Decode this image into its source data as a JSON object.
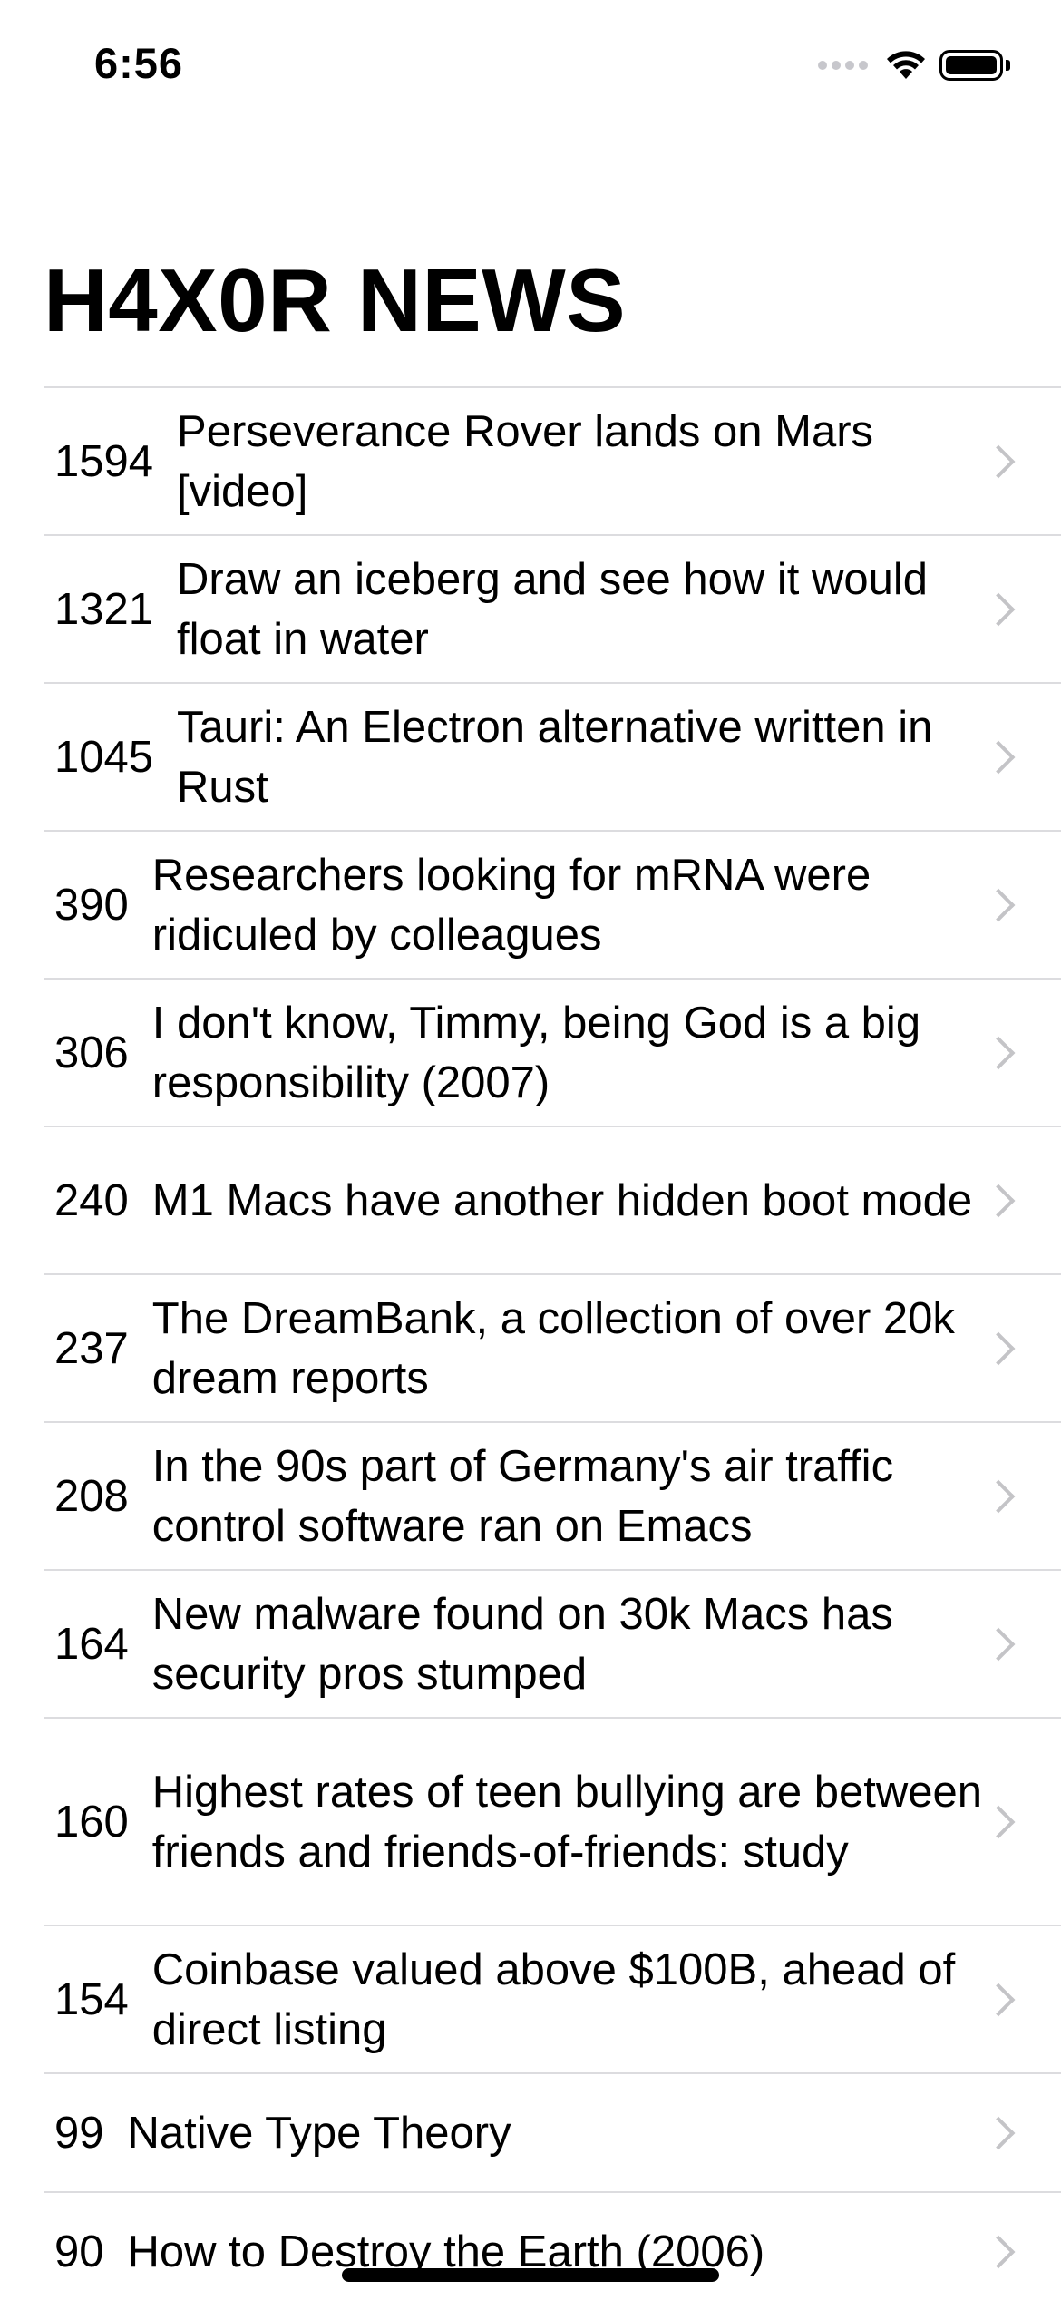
{
  "status_bar": {
    "time": "6:56"
  },
  "header": {
    "title": "H4X0R NEWS"
  },
  "stories": [
    {
      "points": "1594",
      "title": "Perseverance Rover lands on Mars [video]"
    },
    {
      "points": "1321",
      "title": "Draw an iceberg and see how it would float in water"
    },
    {
      "points": "1045",
      "title": "Tauri: An Electron alternative written in Rust"
    },
    {
      "points": "390",
      "title": "Researchers looking for mRNA were ridiculed by colleagues"
    },
    {
      "points": "306",
      "title": "I don't know, Timmy, being God is a big responsibility (2007)"
    },
    {
      "points": "240",
      "title": "M1 Macs have another hidden boot mode"
    },
    {
      "points": "237",
      "title": "The DreamBank, a collection of over 20k dream reports"
    },
    {
      "points": "208",
      "title": "In the 90s part of Germany's air traffic control software ran on Emacs"
    },
    {
      "points": "164",
      "title": "New malware found on 30k Macs has security pros stumped"
    },
    {
      "points": "160",
      "title": "Highest rates of teen bullying are between friends and friends-of-friends: study"
    },
    {
      "points": "154",
      "title": "Coinbase valued above $100B, ahead of direct listing"
    },
    {
      "points": "99",
      "title": "Native Type Theory"
    },
    {
      "points": "90",
      "title": "How to Destroy the Earth (2006)"
    }
  ],
  "icons": {
    "signal": "cellular-signal-icon",
    "wifi": "wifi-icon",
    "battery": "battery-icon",
    "chevron": "chevron-right-icon"
  }
}
